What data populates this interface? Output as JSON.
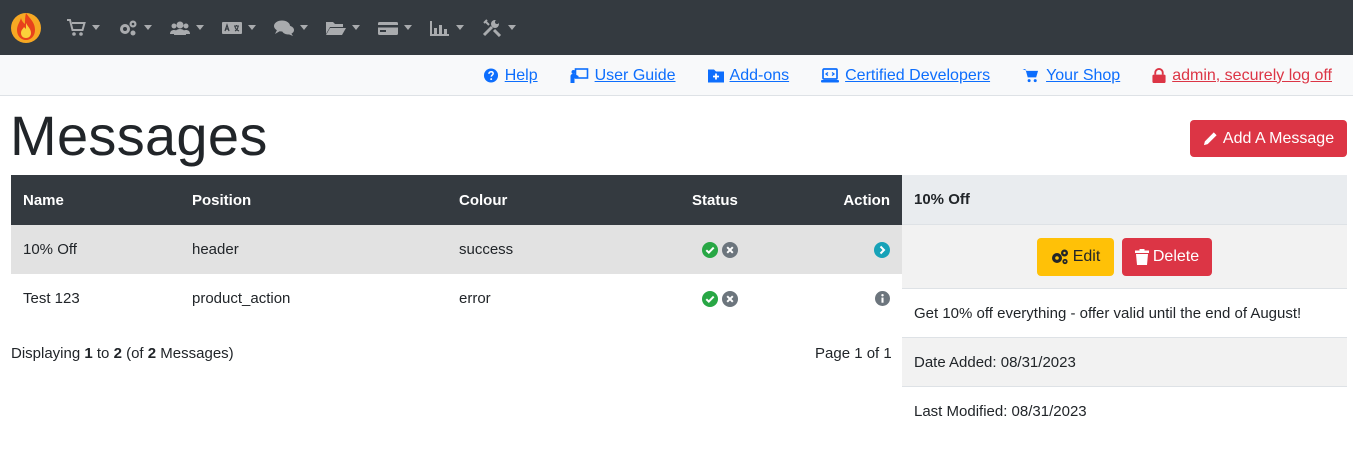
{
  "topnav": {
    "menu": [
      {
        "icon": "cart-icon"
      },
      {
        "icon": "gears-icon"
      },
      {
        "icon": "users-icon"
      },
      {
        "icon": "language-icon"
      },
      {
        "icon": "comments-icon"
      },
      {
        "icon": "folder-open-icon"
      },
      {
        "icon": "credit-card-icon"
      },
      {
        "icon": "chart-icon"
      },
      {
        "icon": "tools-icon"
      }
    ]
  },
  "subbar": {
    "help": "Help",
    "user_guide": "User Guide",
    "addons": "Add-ons",
    "certified": "Certified Developers",
    "shop": "Your Shop",
    "logoff": "admin, securely log off"
  },
  "page": {
    "title": "Messages",
    "add_button": "Add A Message"
  },
  "table": {
    "headers": {
      "name": "Name",
      "position": "Position",
      "colour": "Colour",
      "status": "Status",
      "action": "Action"
    },
    "rows": [
      {
        "name": "10% Off",
        "position": "header",
        "colour": "success",
        "status": "enabled",
        "action": "selected"
      },
      {
        "name": "Test 123",
        "position": "product_action",
        "colour": "error",
        "status": "enabled",
        "action": "info"
      }
    ]
  },
  "footer": {
    "displaying": "Displaying",
    "from": "1",
    "to_word": "to",
    "to": "2",
    "of_open": "(of",
    "total": "2",
    "of_close": "Messages)",
    "page_info": "Page 1 of 1"
  },
  "panel": {
    "title": "10% Off",
    "edit": "Edit",
    "delete": "Delete",
    "message": "Get 10% off everything - offer valid until the end of August!",
    "date_added": "Date Added: 08/31/2023",
    "last_modified": "Last Modified: 08/31/2023"
  },
  "colors": {
    "navbar": "#343a40",
    "link": "#0d6efd",
    "danger": "#dc3545",
    "warning": "#ffc107",
    "success": "#28a745",
    "info": "#17a2b8"
  }
}
